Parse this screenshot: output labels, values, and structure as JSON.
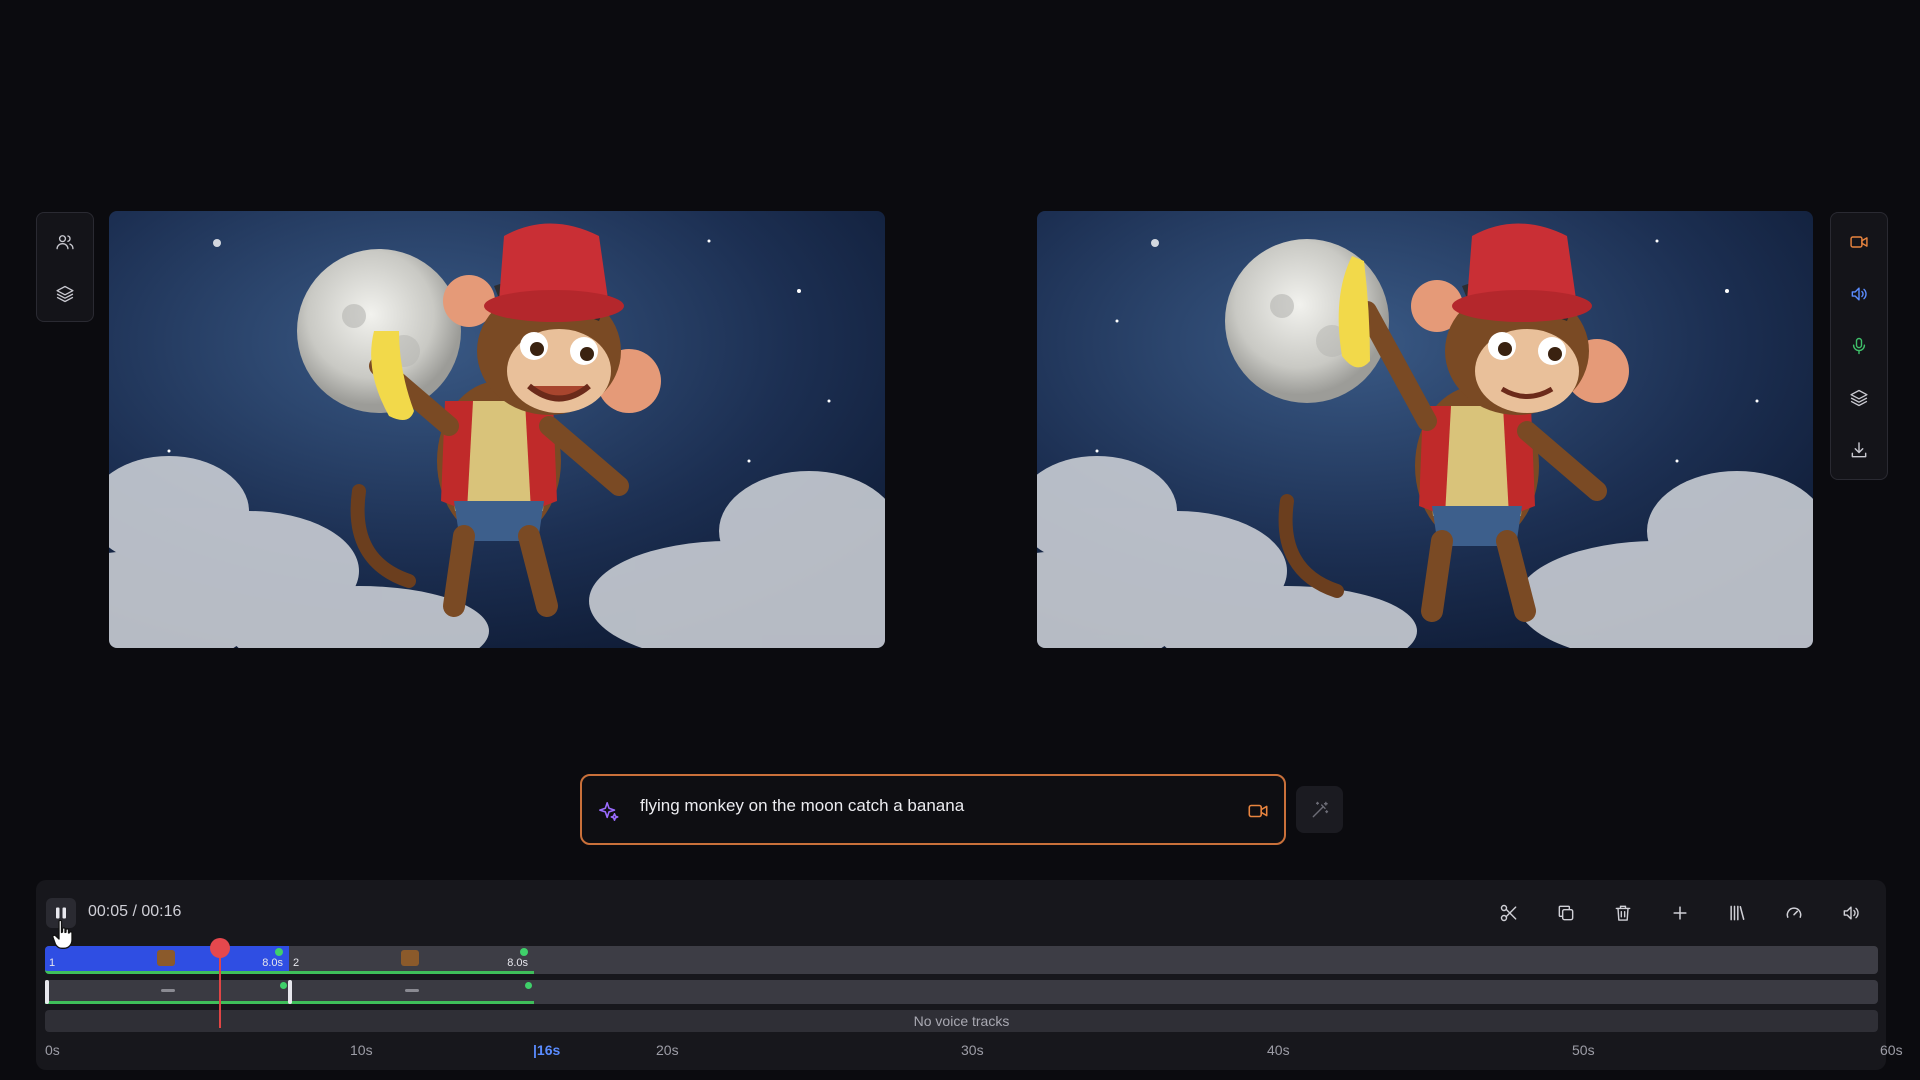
{
  "left_panel": {
    "items": [
      {
        "icon": "users-icon"
      },
      {
        "icon": "layers-icon"
      }
    ]
  },
  "right_panel": {
    "items": [
      {
        "icon": "video-camera-icon",
        "color": "#e8843f"
      },
      {
        "icon": "speaker-icon",
        "color": "#5b8cff"
      },
      {
        "icon": "microphone-icon",
        "color": "#3fc06a"
      },
      {
        "icon": "layers-icon",
        "color": "#c9c9d0"
      },
      {
        "icon": "download-icon",
        "color": "#c9c9d0"
      }
    ]
  },
  "prompt": {
    "text": "flying monkey on the moon catch a banana",
    "border_color": "#c9703a"
  },
  "playback": {
    "current": "00:05",
    "separator": " / ",
    "total": "00:16",
    "readout": "00:05 / 00:16",
    "state": "playing"
  },
  "toolbar": {
    "items": [
      "scissors-icon",
      "copy-icon",
      "trash-icon",
      "plus-icon",
      "library-icon",
      "speed-icon",
      "volume-icon"
    ]
  },
  "timeline": {
    "clips": [
      {
        "number": "1",
        "duration": "8.0s"
      },
      {
        "number": "2",
        "duration": "8.0s"
      }
    ],
    "voice_track_label": "No voice tracks",
    "ruler": [
      "0s",
      "10s",
      "|16s",
      "20s",
      "30s",
      "40s",
      "50s",
      "60s"
    ]
  }
}
